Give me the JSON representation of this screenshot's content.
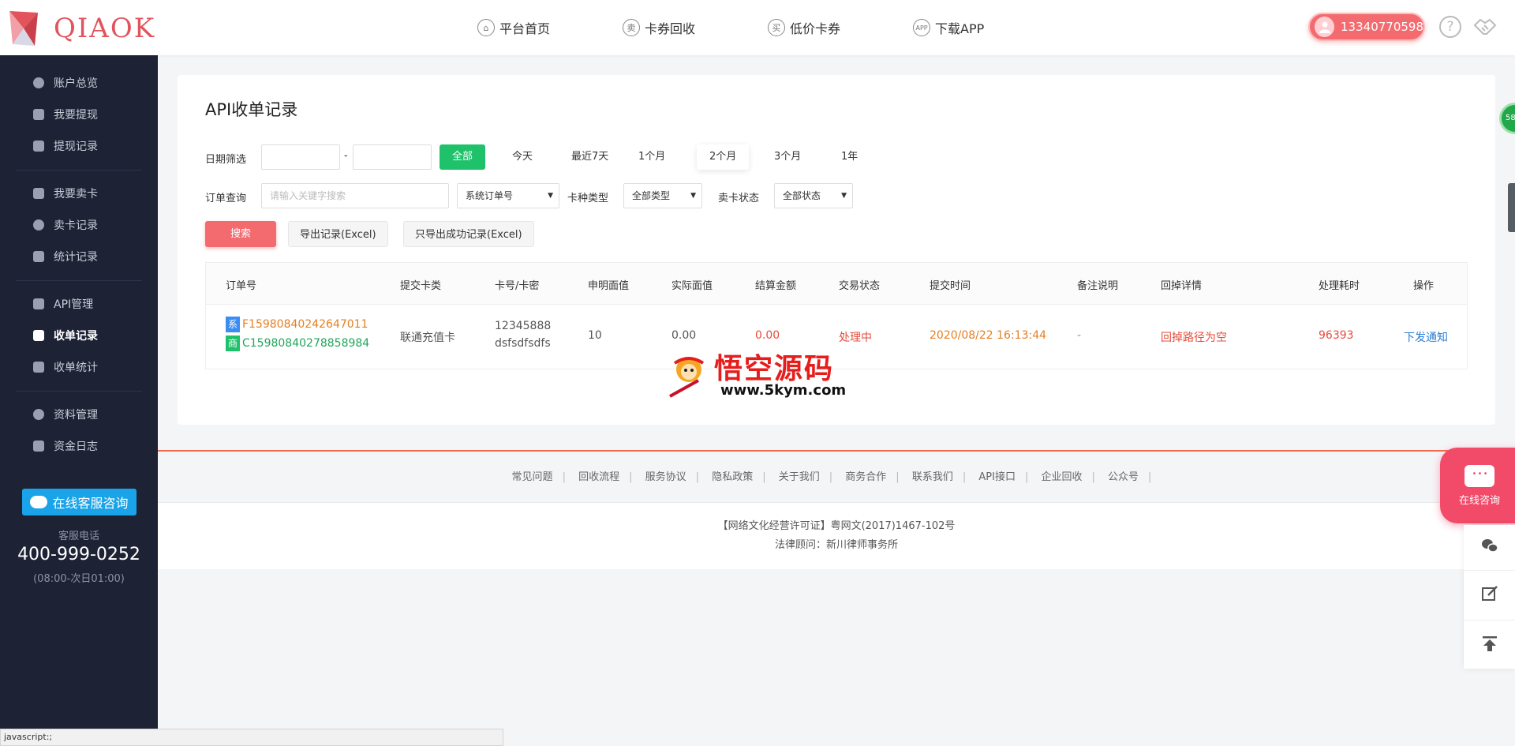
{
  "header": {
    "logo_text": "QIAOK",
    "nav": [
      {
        "icon": "home-icon",
        "glyph": "⌂",
        "label": "平台首页"
      },
      {
        "icon": "sell-icon",
        "glyph": "卖",
        "label": "卡券回收"
      },
      {
        "icon": "buy-icon",
        "glyph": "买",
        "label": "低价卡券"
      },
      {
        "icon": "app-icon",
        "glyph": "APP",
        "label": "下载APP"
      }
    ],
    "user_phone": "13340770598"
  },
  "sidebar": {
    "items": [
      {
        "label": "账户总览"
      },
      {
        "label": "我要提现"
      },
      {
        "label": "提现记录"
      },
      {
        "label": "我要卖卡"
      },
      {
        "label": "卖卡记录"
      },
      {
        "label": "统计记录"
      },
      {
        "label": "API管理"
      },
      {
        "label": "收单记录"
      },
      {
        "label": "收单统计"
      },
      {
        "label": "资料管理"
      },
      {
        "label": "资金日志"
      }
    ],
    "service_button": "在线客服咨询",
    "service_phone_label": "客服电话",
    "service_phone": "400-999-0252",
    "service_hours": "(08:00-次日01:00)"
  },
  "main": {
    "title": "API收单记录",
    "filters": {
      "date_label": "日期筛选",
      "date_sep": "-",
      "date_buttons": [
        "全部",
        "今天",
        "最近7天",
        "1个月",
        "2个月",
        "3个月",
        "1年"
      ],
      "order_label": "订单查询",
      "search_placeholder": "请输入关键字搜索",
      "order_type_value": "系统订单号",
      "card_type_label": "卡种类型",
      "card_type_value": "全部类型",
      "card_status_label": "卖卡状态",
      "card_status_value": "全部状态",
      "search_button": "搜索",
      "export_button": "导出记录(Excel)",
      "export_success_button": "只导出成功记录(Excel)"
    },
    "table": {
      "headers": [
        "订单号",
        "提交卡类",
        "卡号/卡密",
        "申明面值",
        "实际面值",
        "结算金额",
        "交易状态",
        "提交时间",
        "备注说明",
        "回掉详情",
        "处理耗时",
        "操作"
      ],
      "rows": [
        {
          "sys_tag": "系",
          "sys_order": "F15980840242647011",
          "mer_tag": "商",
          "mer_order": "C15980840278858984",
          "card_type": "联通充值卡",
          "card_no": "12345888",
          "card_pwd": "dsfsdfsdfs",
          "declared": "10",
          "actual": "0.00",
          "settle": "0.00",
          "status": "处理中",
          "time": "2020/08/22 16:13:44",
          "remark": "-",
          "callback": "回掉路径为空",
          "duration": "96393",
          "action": "下发通知"
        }
      ]
    }
  },
  "watermark": {
    "cn": "悟空源码",
    "url": "www.5kym.com"
  },
  "footer": {
    "links": [
      "常见问题",
      "回收流程",
      "服务协议",
      "隐私政策",
      "关于我们",
      "商务合作",
      "联系我们",
      "API接口",
      "企业回收",
      "公众号"
    ],
    "license": "【网络文化经营许可证】粤网文(2017)1467-102号",
    "legal": "法律顾问：新川律师事务所"
  },
  "floating": {
    "consult_label": "在线咨询",
    "badge": "58"
  },
  "statusbar": "javascript:;",
  "colors": {
    "accent_red": "#f46b6f",
    "green": "#1fc26b",
    "sidebar_bg": "#1d2235",
    "order_orange": "#e67e22",
    "status_red": "#e74c3c"
  }
}
